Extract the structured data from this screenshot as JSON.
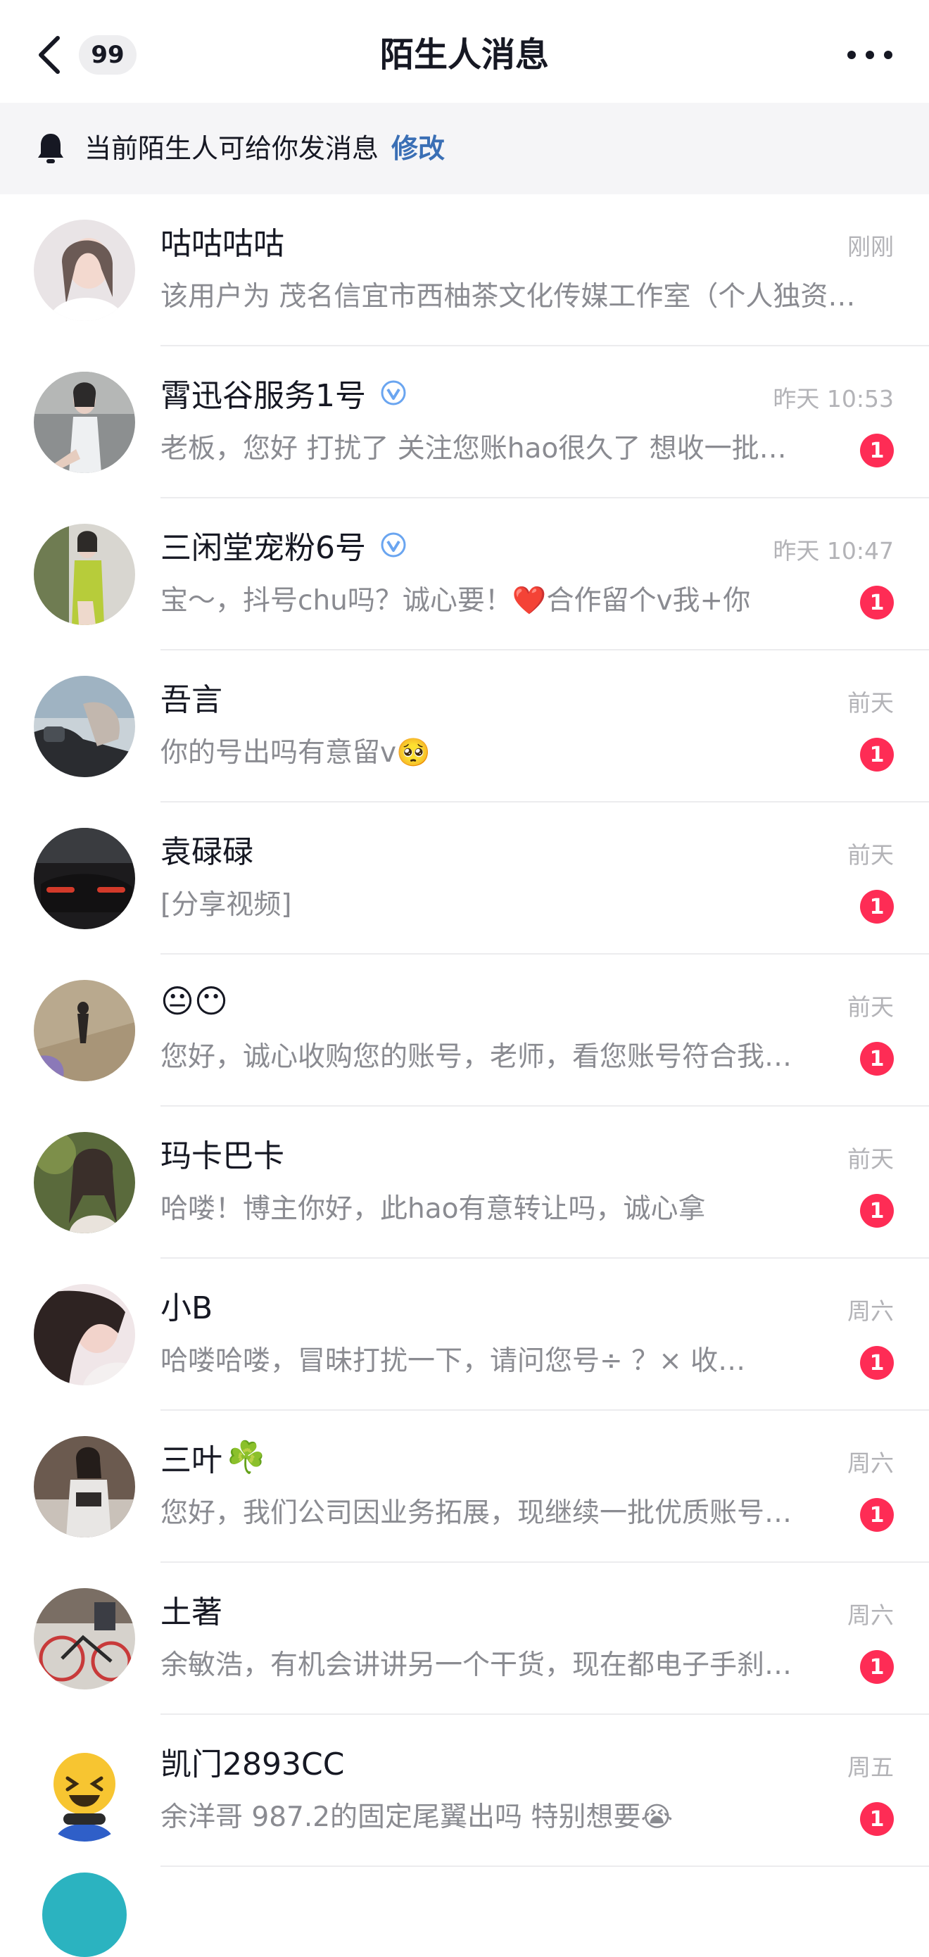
{
  "header": {
    "title": "陌生人消息",
    "unread_total": "99"
  },
  "notice": {
    "text": "当前陌生人可给你发消息",
    "link": "修改"
  },
  "colors": {
    "accent_red": "#fe2c55",
    "link_blue": "#3a6fb5",
    "verify_blue": "#6aa5f0"
  },
  "messages": [
    {
      "name": "咕咕咕咕",
      "time": "刚刚",
      "preview": "该用户为 茂名信宜市西柚茶文化传媒工作室（个人独资…",
      "unread": "",
      "verified": false
    },
    {
      "name": "霄迅谷服务1号",
      "time": "昨天 10:53",
      "preview": "老板，您好 打扰了 关注您账hao很久了  想收一批…",
      "unread": "1",
      "verified": true
    },
    {
      "name": "三闲堂宠粉6号",
      "time": "昨天 10:47",
      "preview": "宝～，抖号chu吗？诚心要！",
      "preview_emoji": "❤️",
      "preview_tail": "合作留个v我+你",
      "unread": "1",
      "verified": true
    },
    {
      "name": "吾言",
      "time": "前天",
      "preview": "你的号出吗有意留v",
      "preview_emoji": "🥺",
      "unread": "1",
      "verified": false
    },
    {
      "name": "袁碌碌",
      "time": "前天",
      "preview": "[分享视频]",
      "unread": "1",
      "verified": false
    },
    {
      "name": "",
      "name_emoji": "😐😶",
      "time": "前天",
      "preview": "您好，诚心收购您的账号，老师，看您账号符合我…",
      "unread": "1",
      "verified": false
    },
    {
      "name": "玛卡巴卡",
      "time": "前天",
      "preview": "哈喽！博主你好，此hao有意转让吗，诚心拿",
      "unread": "1",
      "verified": false
    },
    {
      "name": "小B",
      "time": "周六",
      "preview": "哈喽哈喽，冒昧打扰一下，请问您号÷ ？× 收…",
      "unread": "1",
      "verified": false
    },
    {
      "name": "三叶",
      "name_emoji": "☘️",
      "time": "周六",
      "preview": "您好，我们公司因业务拓展，现继续一批优质账号…",
      "unread": "1",
      "verified": false
    },
    {
      "name": "土著",
      "time": "周六",
      "preview": "余敏浩，有机会讲讲另一个干货，现在都电子手刹…",
      "unread": "1",
      "verified": false
    },
    {
      "name": "凯门2893CC",
      "time": "周五",
      "preview": "余洋哥 987.2的固定尾翼出吗 特别想要",
      "preview_emoji": "😭",
      "unread": "1",
      "verified": false
    }
  ]
}
